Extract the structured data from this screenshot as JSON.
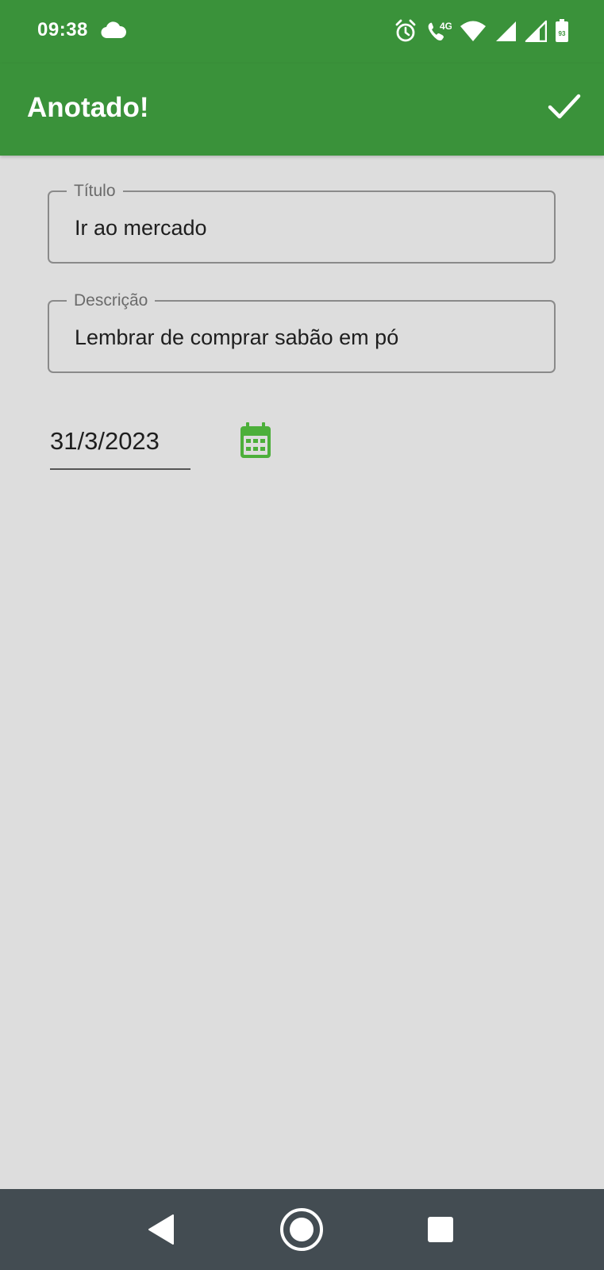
{
  "status_bar": {
    "time": "09:38",
    "icons": [
      "cloud-icon",
      "alarm-icon",
      "wifi-call-icon",
      "wifi-icon",
      "signal-icon",
      "signal-icon",
      "battery-icon"
    ],
    "network_label": "4G",
    "battery_level": "93"
  },
  "app_bar": {
    "title": "Anotado!",
    "confirm_icon": "check-icon"
  },
  "form": {
    "title_field": {
      "label": "Título",
      "value": "Ir ao mercado"
    },
    "description_field": {
      "label": "Descrição",
      "value": "Lembrar de comprar sabão em pó"
    },
    "date_field": {
      "value": "31/3/2023",
      "picker_icon": "calendar-icon"
    }
  },
  "nav_bar": {
    "buttons": [
      "back-icon",
      "home-icon",
      "recents-icon"
    ]
  },
  "colors": {
    "primary": "#3a923a",
    "background": "#dddddd",
    "nav_bar": "#434c52",
    "calendar_icon": "#4caf3a",
    "text": "#1e1e1e",
    "label": "#6b6b6b"
  }
}
